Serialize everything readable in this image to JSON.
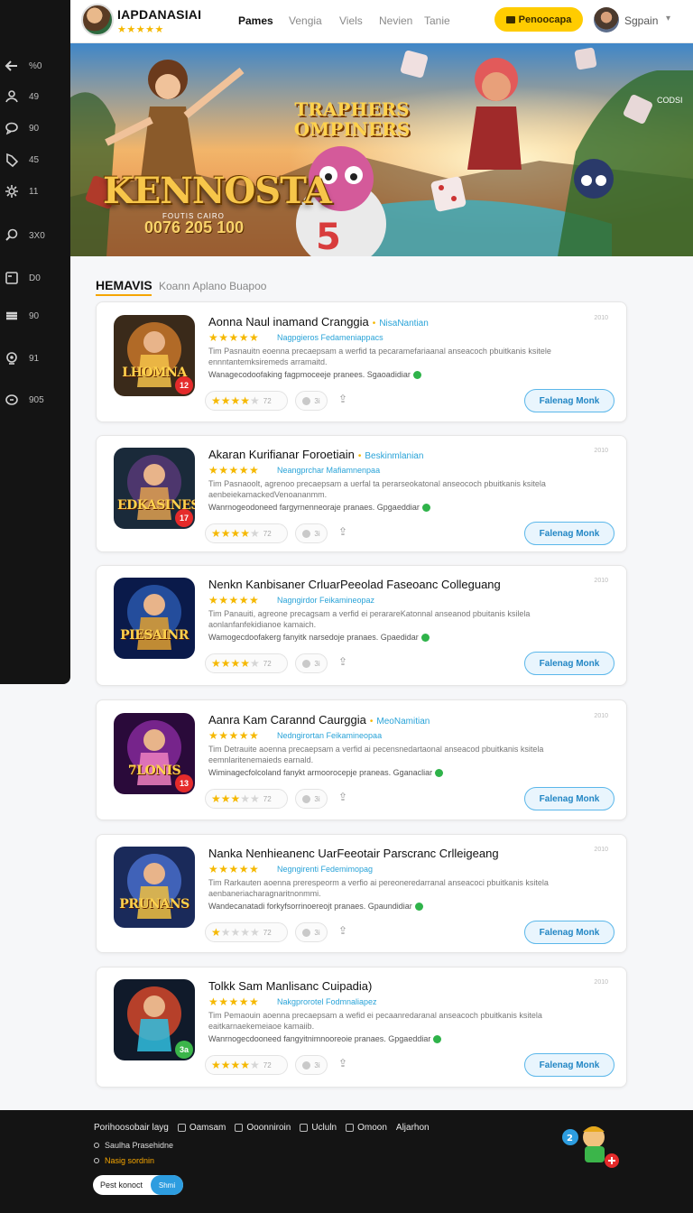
{
  "header": {
    "brand": "IAPDANASIAI",
    "brand_stars": "★★★★★",
    "nav": [
      "Pames",
      "Vengia",
      "Viels",
      "Nevien",
      "Tanie"
    ],
    "cta_label": "Penoocapa",
    "user_name": "Sgpain"
  },
  "sidebar": {
    "items": [
      {
        "icon": "arrow-left-icon",
        "count": "%0"
      },
      {
        "icon": "users-icon",
        "count": "49"
      },
      {
        "icon": "chat-icon",
        "count": "90"
      },
      {
        "icon": "tag-icon",
        "count": "45"
      },
      {
        "icon": "gear-icon",
        "count": "11"
      },
      {
        "icon": "search-icon",
        "count": "3X0"
      },
      {
        "icon": "image-icon",
        "count": "D0"
      },
      {
        "icon": "layers-icon",
        "count": "90"
      },
      {
        "icon": "location-icon",
        "count": "91"
      },
      {
        "icon": "message-icon",
        "count": "905"
      }
    ]
  },
  "banner": {
    "title": "KENNOSTA",
    "subtitle": "FOUTIS CAIRO",
    "number": "0076 205 100",
    "logo_text": "TRAPHERS OMPINERS",
    "corner": "CODSI"
  },
  "section": {
    "title": "HEMAVIS",
    "subtitle": "Koann Aplano Buapoo"
  },
  "cards": [
    {
      "title": "Aonna Naul inamand Cranggia",
      "tag": "NisaNantian",
      "stars": "★★★★★",
      "stars_caption": "Nagpgieros Fedameniappacs",
      "desc": "Tim Pasnauitn eoenna precaepsam a werfid ta pecaramefariaanal anseacoch pbuitkanis ksitele ennntantemksiremeds arramaitd.",
      "desc2": "Wanagecodoofaking fagpmoceeje pranees. Sgaoadidiar",
      "thumb_text": "LHOMNA",
      "badge": "12",
      "rating_value": "72",
      "likes": "3i",
      "action": "Falenag Monk",
      "corner": "2010",
      "rating_stars": 4
    },
    {
      "title": "Akaran Kurifianar Foroetiain",
      "tag": "Beskinmlanian",
      "stars": "★★★★★",
      "stars_caption": "Neangprchar Mafiamnenpaa",
      "desc": "Tim Pasnaoolt, agrenoo precaepsam a uerfal ta perarseokatonal anseococh pbuitkanis ksitela aenbeiekamackedVenoananmm.",
      "desc2": "Wanrnogeodoneed fargyrnenneoraje pranaes. Gpgaeddiar",
      "thumb_text": "EDKASINES",
      "badge": "17",
      "rating_value": "72",
      "likes": "3i",
      "action": "Falenag Monk",
      "corner": "2010",
      "rating_stars": 4
    },
    {
      "title": "Nenkn Kanbisaner CrluarPeeolad Faseoanc Colleguang",
      "tag": "",
      "stars": "★★★★★",
      "stars_caption": "Nagngirdor Feikamineopaz",
      "desc": "Tim Panauiti, agreone precagsam a verfid ei perarareKatonnal anseanod pbuitanis ksilela aonlanfanfekidianoe kamaich.",
      "desc2": "Wamogecdoofakerg fanyitk narsedoje pranaes. Gpaedidar",
      "thumb_text": "PIESAINR",
      "badge": "",
      "rating_value": "72",
      "likes": "3i",
      "action": "Falenag Monk",
      "corner": "2010",
      "rating_stars": 4
    },
    {
      "title": "Aanra Kam Carannd Caurggia",
      "tag": "MeoNamitian",
      "stars": "★★★★★",
      "stars_caption": "Nedngirortan Feikamineopaa",
      "desc": "Tim Detrauite aoenna precaepsam a verfid ai pecensnedartaonal anseacod pbuitkanis ksitela eemnlaritenemaieds earnald.",
      "desc2": "Wiminagecfolcoland fanykt armoorocepje praneas. Gganacliar",
      "thumb_text": "7LONIS",
      "badge": "13",
      "rating_value": "72",
      "likes": "3i",
      "action": "Falenag Monk",
      "corner": "2010",
      "rating_stars": 3
    },
    {
      "title": "Nanka Nenhieanenc UarFeeotair Parscranc Crlleigeang",
      "tag": "",
      "stars": "★★★★★",
      "stars_caption": "Negngirenti Fedemimopag",
      "desc": "Tim Rarkauten aoenna prerespeorm a verfio ai pereoneredarranal anseacoci pbuitkanis ksitela aenbaneriacharagnaritnonmmi.",
      "desc2": "Wandecanatadi forkyfsorrinoereojt pranaes. Gpaundidiar",
      "thumb_text": "PRUNANS",
      "badge": "",
      "rating_value": "72",
      "likes": "3i",
      "action": "Falenag Monk",
      "corner": "2010",
      "rating_stars": 1
    },
    {
      "title": "Tolkk Sam Manlisanc Cuipadia)",
      "tag": "",
      "stars": "★★★★★",
      "stars_caption": "Nakgprorotel Fodmnaliapez",
      "desc": "Tim Pemaouin aoenna precaepsam a wefid ei pecaanredaranal anseacoch pbuitkanis ksitela eaitkarnaekemeiaoe kamaiib.",
      "desc2": "Wanrnogecdooneed fangyitnimnooreoie pranaes. Gpgaeddiar",
      "thumb_text": "",
      "badge": "3a",
      "badge_color": "green",
      "rating_value": "72",
      "likes": "3i",
      "action": "Falenag Monk",
      "corner": "2010",
      "rating_stars": 4
    }
  ],
  "footer": {
    "row": [
      "Porihoosobair layg",
      "Oamsam",
      "Ooonniroin",
      "Ucluln",
      "Omoon",
      "Aljarhon"
    ],
    "line1": "Saulha Prasehidne",
    "line2": "Nasig sordnin",
    "input_placeholder": "Pest konoct",
    "go_label": "Shmi"
  },
  "colors": {
    "accent": "#ffcc00",
    "sidebar_bg": "#141414",
    "link_blue": "#29a3d8",
    "star": "#f5b800"
  }
}
